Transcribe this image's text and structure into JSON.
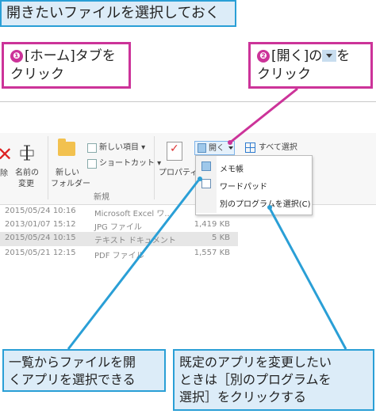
{
  "header": {
    "title": "開きたいファイルを選択しておく"
  },
  "steps": [
    {
      "num": "❶",
      "line1": "[ホーム]タブを",
      "line2": "クリック"
    },
    {
      "num": "❷",
      "line1_a": "[開く]の",
      "line1_b": "を",
      "line2": "クリック"
    }
  ],
  "notes": [
    {
      "line1": "一覧からファイルを開",
      "line2": "くアプリを選択できる"
    },
    {
      "line1": "既定のアプリを変更したい",
      "line2": "ときは［別のプログラムを",
      "line3": "選択］をクリックする"
    }
  ],
  "ribbon": {
    "delete_label": "除",
    "rename_label_1": "名前の",
    "rename_label_2": "変更",
    "newfolder_label_1": "新しい",
    "newfolder_label_2": "フォルダー",
    "new_item_label": "新しい項目 ▾",
    "shortcut_label": "ショートカット ▾",
    "group_new": "新規",
    "properties_label": "プロパティ",
    "open_label": "開く",
    "select_all_label": "すべて選択",
    "group_open_partial": "開"
  },
  "open_menu": {
    "items": [
      "メモ帳",
      "ワードパッド",
      "別のプログラムを選択(C)"
    ]
  },
  "file_rows": [
    {
      "date": "2015/05/24 10:16",
      "type": "Microsoft Excel ワ...",
      "size": ""
    },
    {
      "date": "2013/01/07 15:12",
      "type": "JPG ファイル",
      "size": "1,419 KB"
    },
    {
      "date": "2015/05/24 10:15",
      "type": "テキスト ドキュメント",
      "size": "5 KB"
    },
    {
      "date": "2015/05/21 12:15",
      "type": "PDF ファイル",
      "size": "1,557 KB"
    }
  ],
  "colors": {
    "accent_blue": "#2a9fd6",
    "step_magenta": "#cc3399",
    "note_fill": "#dcecf8"
  }
}
